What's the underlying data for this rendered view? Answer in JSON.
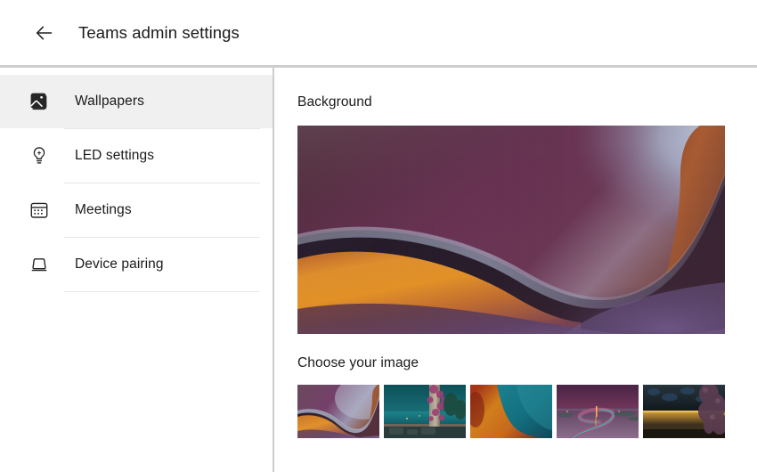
{
  "header": {
    "back_icon": "arrow-left-icon",
    "title": "Teams admin settings"
  },
  "sidebar": {
    "items": [
      {
        "id": "wallpapers",
        "label": "Wallpapers",
        "icon": "image-icon",
        "selected": true
      },
      {
        "id": "led-settings",
        "label": "LED settings",
        "icon": "lightbulb-icon",
        "selected": false
      },
      {
        "id": "meetings",
        "label": "Meetings",
        "icon": "calendar-icon",
        "selected": false
      },
      {
        "id": "device-pairing",
        "label": "Device pairing",
        "icon": "device-screen-icon",
        "selected": false
      }
    ]
  },
  "main": {
    "background_section": {
      "title": "Background",
      "preview_name": "abstract-wave-wallpaper",
      "preview_colors": {
        "dark_plum": "#3c2533",
        "deep_purple": "#5b2f4e",
        "magenta": "#6e3456",
        "blue_grey": "#9aa3bd",
        "orange": "#e0892a",
        "copper": "#a8512a",
        "shadow": "#231724",
        "lavender": "#6d5a86"
      }
    },
    "choose_section": {
      "title": "Choose your image",
      "thumbnails": [
        {
          "id": "thumb-1",
          "name": "abstract-wave-wallpaper",
          "selected": true
        },
        {
          "id": "thumb-2",
          "name": "teal-seaside-terrace",
          "selected": false
        },
        {
          "id": "thumb-3",
          "name": "orange-teal-gradient",
          "selected": false
        },
        {
          "id": "thumb-4",
          "name": "purple-winding-road",
          "selected": false
        },
        {
          "id": "thumb-5",
          "name": "night-lit-wall-tree",
          "selected": false
        }
      ]
    }
  },
  "colors": {
    "page_background": "#ffffff",
    "selected_row": "#f0f0f0",
    "border": "#cdcdcd",
    "divider": "#e6e6e6",
    "text": "#1a1a1a"
  }
}
